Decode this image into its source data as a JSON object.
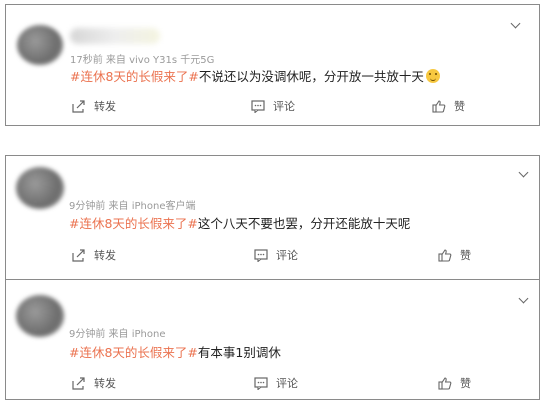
{
  "posts": [
    {
      "meta": "17秒前  来自 vivo Y31s 千元5G",
      "tag": "#连休8天的长假来了#",
      "text": "不说还以为没调休呢，分开放一共放十天",
      "has_emoji": true,
      "actions": {
        "repost": "转发",
        "comment": "评论",
        "like": "赞"
      }
    },
    {
      "meta": "9分钟前  来自 iPhone客户端",
      "tag": "#连休8天的长假来了#",
      "text": "这个八天不要也罢，分开还能放十天呢",
      "has_emoji": false,
      "actions": {
        "repost": "转发",
        "comment": "评论",
        "like": "赞"
      }
    },
    {
      "meta": "9分钟前  来自 iPhone",
      "tag": "#连休8天的长假来了#",
      "text": "有本事1别调休",
      "has_emoji": false,
      "actions": {
        "repost": "转发",
        "comment": "评论",
        "like": "赞"
      }
    }
  ],
  "icons": {
    "repost": "repost-icon",
    "comment": "comment-icon",
    "like": "thumbs-up-icon",
    "menu": "chevron-down-icon",
    "emoji": "smile-emoji-icon"
  },
  "colors": {
    "tag": "#eb7350",
    "meta": "#9a9a9a",
    "border": "#8a8a8a"
  }
}
